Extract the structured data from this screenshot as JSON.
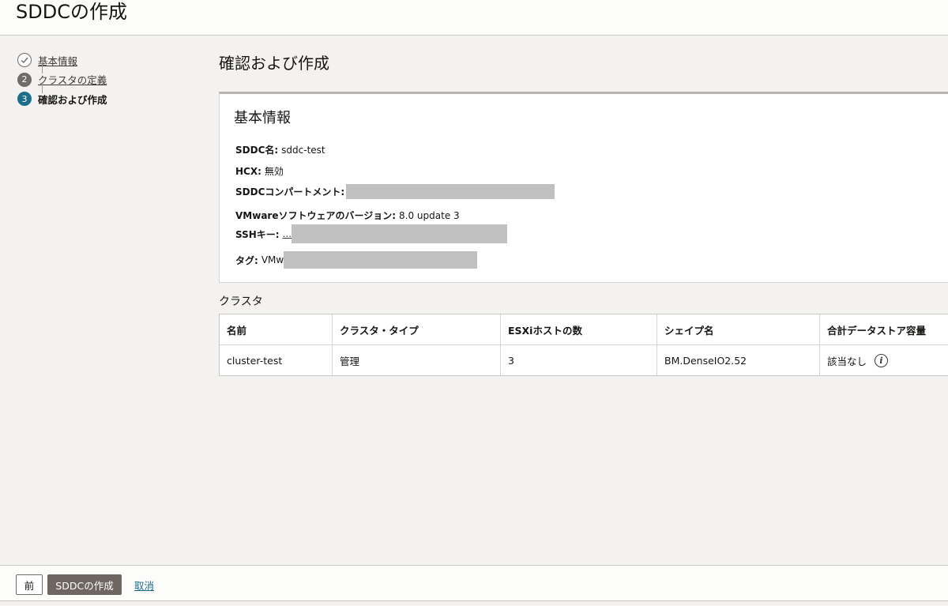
{
  "header": {
    "title": "SDDCの作成"
  },
  "steps": [
    {
      "number": "✓",
      "label": "基本情報",
      "state": "done"
    },
    {
      "number": "2",
      "label": "クラスタの定義",
      "state": "done"
    },
    {
      "number": "3",
      "label": "確認および作成",
      "state": "current"
    }
  ],
  "main": {
    "title": "確認および作成"
  },
  "basic_info": {
    "title": "基本情報",
    "sddc_name_label": "SDDC名:",
    "sddc_name_value": "sddc-test",
    "hcx_label": "HCX:",
    "hcx_value": "無効",
    "compartment_label": "SDDCコンパートメント:",
    "vmware_version_label": "VMwareソフトウェアのバージョン:",
    "vmware_version_value": "8.0 update 3",
    "ssh_key_label": "SSHキー:",
    "ssh_key_value": "...",
    "tag_label": "タグ:",
    "tag_value": "VMw"
  },
  "cluster_section": {
    "label": "クラスタ"
  },
  "cluster_table": {
    "headers": [
      "名前",
      "クラスタ・タイプ",
      "ESXiホストの数",
      "シェイプ名",
      "合計データストア容量"
    ],
    "rows": [
      [
        "cluster-test",
        "管理",
        "3",
        "BM.DenseIO2.52",
        "該当なし"
      ]
    ]
  },
  "footer": {
    "prev_label": "前",
    "create_label": "SDDCの作成",
    "cancel_label": "取消"
  },
  "colors": {
    "accent": "#1c6e8a",
    "primary_button": "#6f6662",
    "background": "#f3f2f1"
  }
}
